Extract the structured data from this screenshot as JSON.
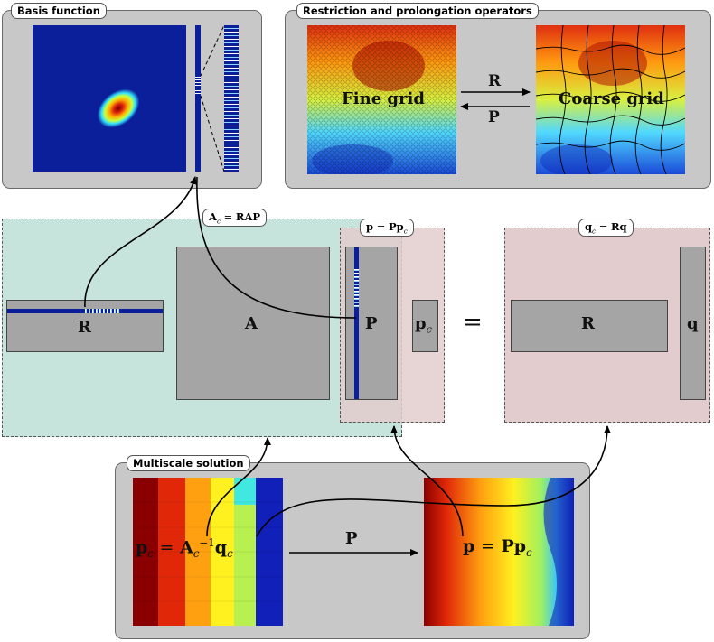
{
  "panels": {
    "basis_function": {
      "title": "Basis function"
    },
    "operators": {
      "title": "Restriction and prolongation operators"
    },
    "multiscale": {
      "title": "Multiscale solution"
    }
  },
  "grids": {
    "fine_label": "Fine grid",
    "coarse_label": "Coarse grid",
    "restriction_symbol": "R",
    "prolongation_symbol": "P"
  },
  "system": {
    "coarse_matrix_eq": {
      "lhs_base": "A",
      "lhs_sub": "c",
      "rhs": "RAP"
    },
    "pressure_eq": {
      "lhs": "p",
      "rhs_main": "Pp",
      "rhs_sub": "c"
    },
    "rhs_eq": {
      "lhs_base": "q",
      "lhs_sub": "c",
      "rhs": "Rq"
    },
    "blocks": {
      "R_left": "R",
      "A": "A",
      "P": "P",
      "pc_base": "p",
      "pc_sub": "c",
      "equals": "=",
      "R_right": "R",
      "q": "q"
    }
  },
  "solution": {
    "coarse_expr": {
      "p": "p",
      "sub_c": "c",
      "eq": "=",
      "A": "A",
      "sup": "−1",
      "q": "q"
    },
    "arrow_label": "P",
    "fine_expr": {
      "p": "p",
      "eq": "=",
      "P": "Pp",
      "sub_c": "c"
    }
  },
  "colors": {
    "panel_gray": "#c8c8c8",
    "teal_box": "#c6e3dc",
    "pink_box": "#e3ccce",
    "matrix_gray": "#a5a5a5",
    "jet_dark_blue": "#0c1f9a"
  }
}
